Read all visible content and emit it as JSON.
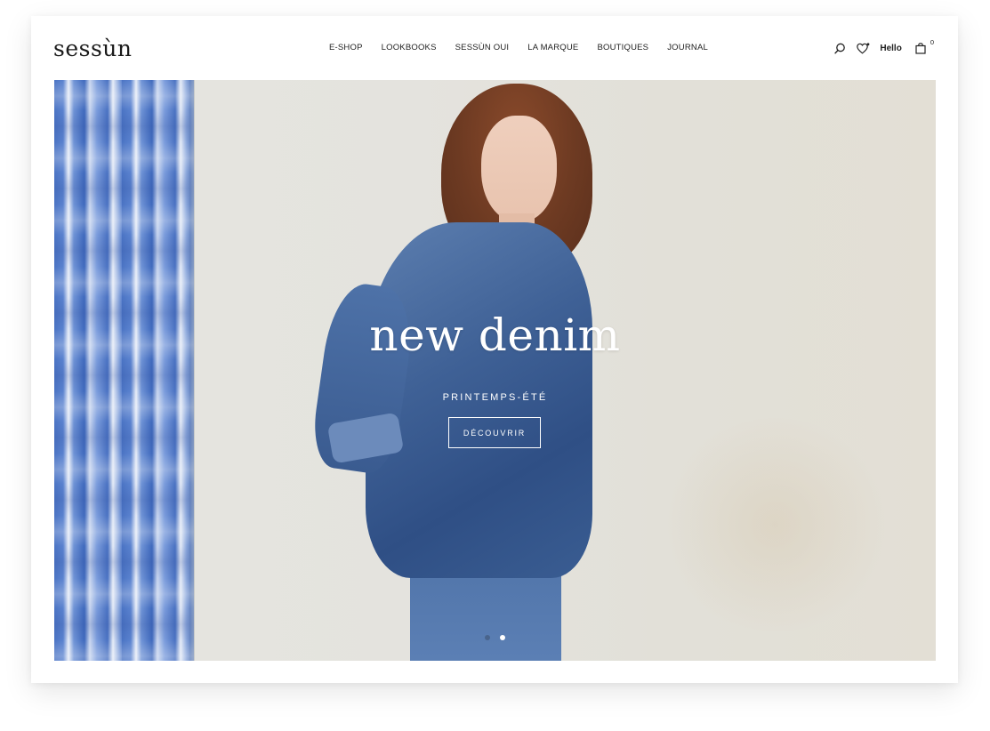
{
  "brand": {
    "logo_text": "sessùn"
  },
  "nav": {
    "items": [
      {
        "label": "E-SHOP"
      },
      {
        "label": "LOOKBOOKS"
      },
      {
        "label": "SESSÙN OUI"
      },
      {
        "label": "LA MARQUE"
      },
      {
        "label": "BOUTIQUES"
      },
      {
        "label": "JOURNAL"
      }
    ]
  },
  "actions": {
    "search_icon": "search-icon",
    "wishlist_icon": "heart-icon",
    "account_label": "Hello",
    "cart_icon": "shopping-bag-icon",
    "cart_count": "0"
  },
  "hero": {
    "title": "new denim",
    "subtitle": "PRINTEMPS-ÉTÉ",
    "cta_label": "DÉCOUVRIR",
    "slides": {
      "count": 2,
      "active_index": 1
    }
  },
  "colors": {
    "text": "#222222",
    "hero_text": "#ffffff",
    "background": "#ffffff"
  }
}
